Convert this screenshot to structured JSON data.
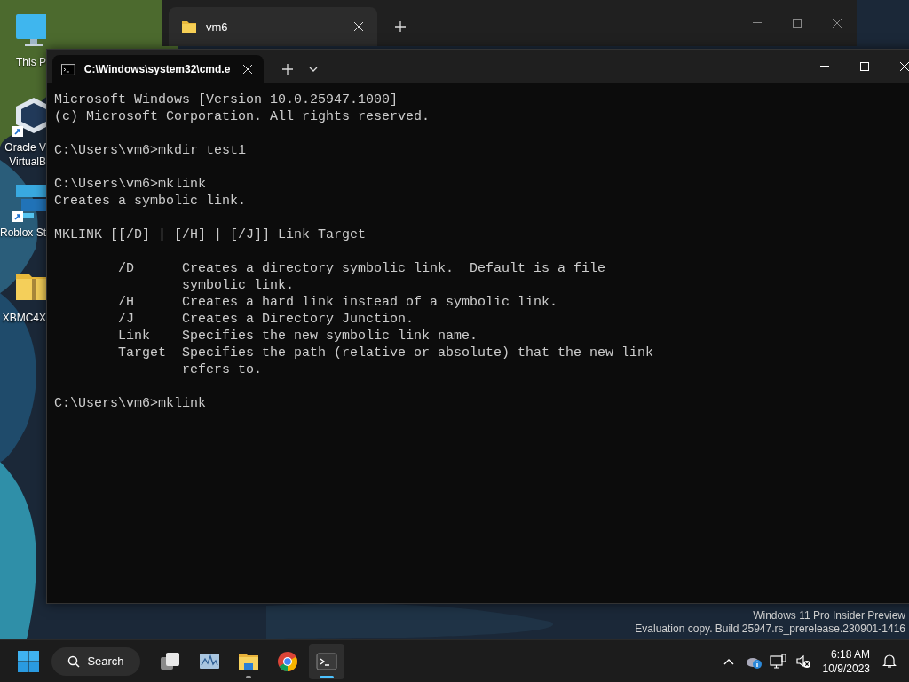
{
  "desktop": {
    "icons": [
      {
        "kind": "monitor",
        "label_lines": [
          "This P"
        ]
      },
      {
        "kind": "cube",
        "label_lines": [
          "Oracle V",
          "VirtualB"
        ],
        "shortcut": true
      },
      {
        "kind": "blocks",
        "label_lines": [
          "Roblox St"
        ],
        "shortcut": true
      },
      {
        "kind": "zip-folder",
        "label_lines": [
          "XBMC4X"
        ],
        "shortcut": false
      }
    ]
  },
  "explorer_window": {
    "tab": {
      "title": "vm6"
    }
  },
  "terminal_window": {
    "tab": {
      "title": "C:\\Windows\\system32\\cmd.e"
    },
    "console": [
      [
        "Microsoft Windows [Version 10.0.25947.1000]",
        "(c) Microsoft Corporation. All rights reserved."
      ],
      [
        "C:\\Users\\vm6>mkdir test1"
      ],
      [
        "C:\\Users\\vm6>mklink",
        "Creates a symbolic link."
      ],
      [
        "MKLINK [[/D] | [/H] | [/J]] Link Target"
      ],
      [
        "        /D      Creates a directory symbolic link.  Default is a file",
        "                symbolic link.",
        "        /H      Creates a hard link instead of a symbolic link.",
        "        /J      Creates a Directory Junction.",
        "        Link    Specifies the new symbolic link name.",
        "        Target  Specifies the path (relative or absolute) that the new link",
        "                refers to."
      ],
      [
        "C:\\Users\\vm6>mklink"
      ]
    ]
  },
  "watermark": [
    "Windows 11 Pro Insider Preview",
    "Evaluation copy. Build 25947.rs_prerelease.230901-1416"
  ],
  "taskbar": {
    "search": {
      "placeholder": "Search"
    },
    "apps": [
      {
        "kind": "task-view",
        "running": false,
        "selected": false
      },
      {
        "kind": "monitor-graph",
        "running": false,
        "selected": false
      },
      {
        "kind": "folder",
        "running": true,
        "selected": false
      },
      {
        "kind": "browser",
        "running": false,
        "selected": false
      },
      {
        "kind": "terminal",
        "running": true,
        "selected": true
      }
    ],
    "time": "6:18 AM",
    "date": "10/9/2023"
  }
}
